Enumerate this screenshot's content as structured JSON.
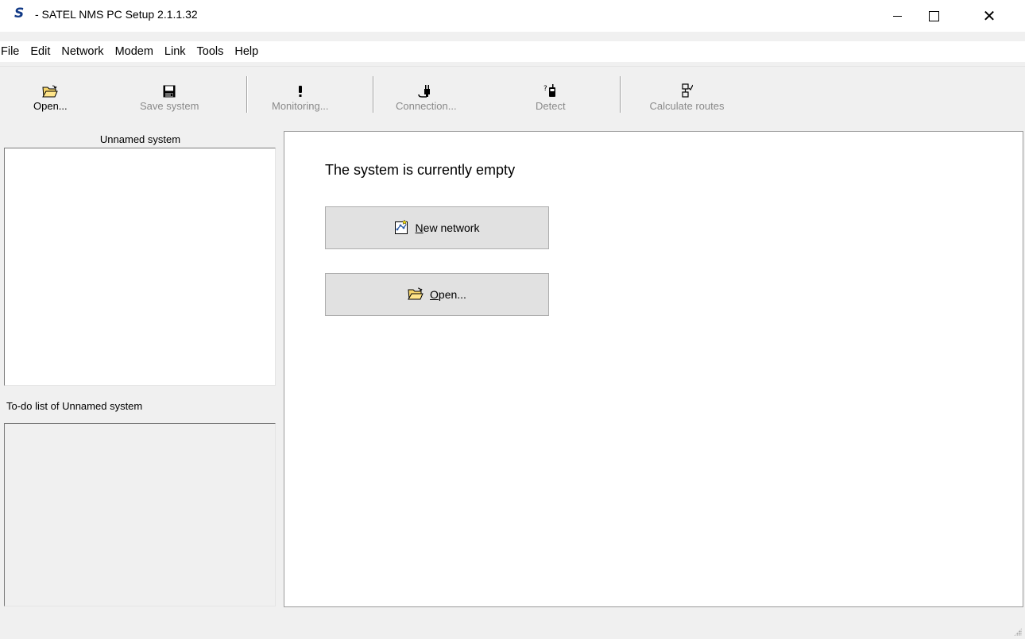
{
  "window": {
    "app_icon": "S",
    "title": " - SATEL NMS PC Setup 2.1.1.32"
  },
  "menu": [
    "File",
    "Edit",
    "Network",
    "Modem",
    "Link",
    "Tools",
    "Help"
  ],
  "toolbar": {
    "open": "Open...",
    "save_system": "Save system",
    "monitoring": "Monitoring...",
    "connection": "Connection...",
    "detect": "Detect",
    "calculate_routes": "Calculate routes"
  },
  "left_panel": {
    "header": "Unnamed system",
    "todo_header": "To-do list of Unnamed system"
  },
  "main": {
    "empty_message": "The system is currently empty",
    "new_network_hotkey": "N",
    "new_network_rest": "ew network",
    "open_hotkey": "O",
    "open_rest": "pen..."
  }
}
